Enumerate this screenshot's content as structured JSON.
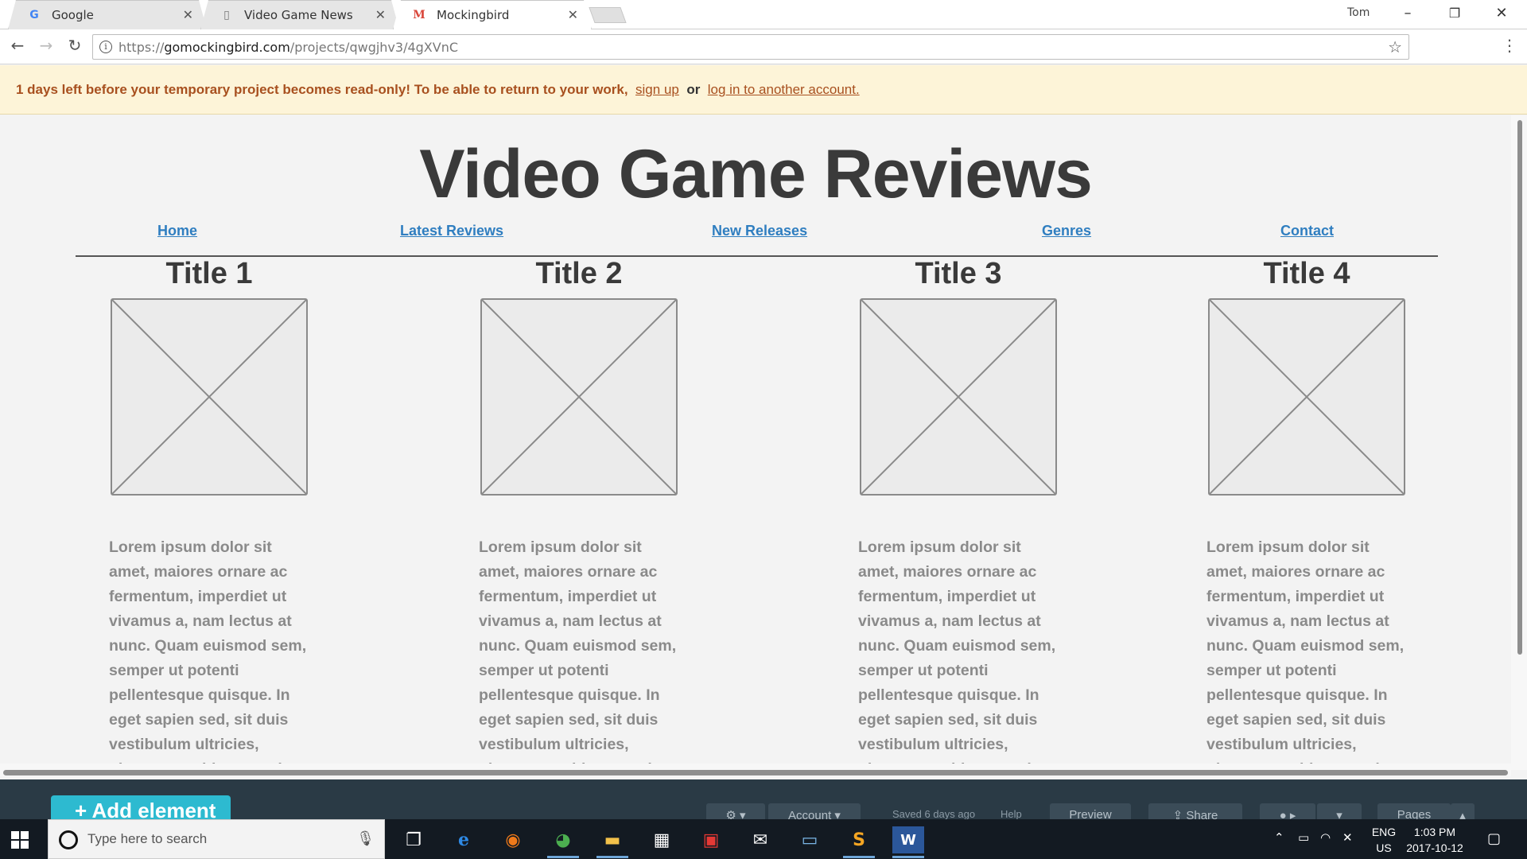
{
  "browser": {
    "tabs": [
      {
        "label": "Google",
        "favicon": "G"
      },
      {
        "label": "Video Game News",
        "favicon": "▯"
      },
      {
        "label": "Mockingbird",
        "favicon": "M"
      }
    ],
    "profile_name": "Tom",
    "url_scheme": "https://",
    "url_host": "gomockingbird.com",
    "url_path": "/projects/qwgjhv3/4gXVnC"
  },
  "notice": {
    "message": "1 days left before your temporary project becomes read-only! To be able to return to your work,",
    "signup_label": "sign up",
    "or_label": "or",
    "login_label": "log in to another account."
  },
  "mockup": {
    "title": "Video Game Reviews",
    "nav": [
      "Home",
      "Latest Reviews",
      "New Releases",
      "Genres",
      "Contact"
    ],
    "columns": [
      {
        "title": "Title 1"
      },
      {
        "title": "Title 2"
      },
      {
        "title": "Title 3"
      },
      {
        "title": "Title 4"
      }
    ],
    "lorem": "Lorem ipsum dolor sit amet, maiores ornare ac fermentum, imperdiet ut vivamus a, nam lectus at nunc. Quam euismod sem, semper ut potenti pellentesque quisque. In eget sapien sed, sit duis vestibulum ultricies, placerat morbi amet vel"
  },
  "appbar": {
    "add_element_label": "+ Add element",
    "account_label": "Account",
    "saved_label": "Saved 6 days ago",
    "help_label": "Help",
    "preview_label": "Preview",
    "share_label": "Share",
    "pages_label": "Pages"
  },
  "taskbar": {
    "search_placeholder": "Type here to search",
    "lang_top": "ENG",
    "lang_bottom": "US",
    "time": "1:03 PM",
    "date": "2017-10-12"
  },
  "colors": {
    "link": "#2f7ec0",
    "notice_text": "#a8501f",
    "notice_bg": "#fdf4d8",
    "add_element": "#2dbad0"
  }
}
